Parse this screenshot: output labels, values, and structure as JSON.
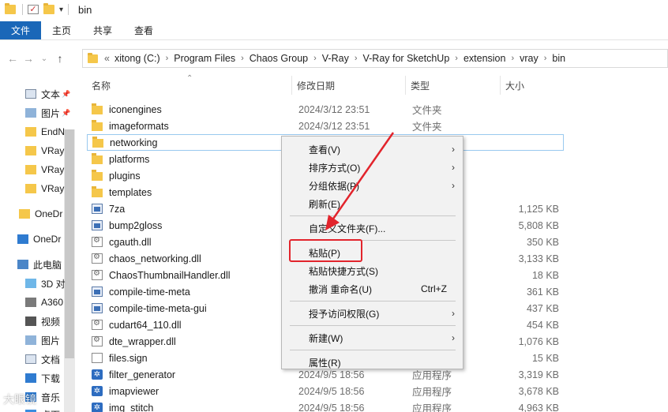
{
  "window": {
    "title": "bin"
  },
  "ribbon": {
    "tabs": [
      "文件",
      "主页",
      "共享",
      "查看"
    ]
  },
  "address": {
    "prefix": "«",
    "crumbs": [
      "xitong (C:)",
      "Program Files",
      "Chaos Group",
      "V-Ray",
      "V-Ray for SketchUp",
      "extension",
      "vray",
      "bin"
    ]
  },
  "nav": {
    "items": [
      {
        "label": "文本",
        "icon": "document-icon",
        "pinned": true
      },
      {
        "label": "图片",
        "icon": "picture-icon",
        "pinned": true
      },
      {
        "label": "EndN",
        "icon": "folder-icon"
      },
      {
        "label": "VRay",
        "icon": "folder-icon"
      },
      {
        "label": "VRay",
        "icon": "folder-icon"
      },
      {
        "label": "VRay",
        "icon": "folder-icon"
      },
      {
        "label": "OneDr",
        "icon": "folder-icon"
      },
      {
        "label": "OneDr",
        "icon": "cloud-icon"
      },
      {
        "label": "此电脑",
        "icon": "computer-icon"
      },
      {
        "label": "3D 对",
        "icon": "cube-icon"
      },
      {
        "label": "A360",
        "icon": "cloud-drive-icon"
      },
      {
        "label": "视频",
        "icon": "video-icon"
      },
      {
        "label": "图片",
        "icon": "picture-icon"
      },
      {
        "label": "文档",
        "icon": "document-icon"
      },
      {
        "label": "下载",
        "icon": "download-icon"
      },
      {
        "label": "音乐",
        "icon": "music-icon"
      },
      {
        "label": "桌面",
        "icon": "desktop-icon"
      }
    ]
  },
  "columns": {
    "name": "名称",
    "date": "修改日期",
    "type": "类型",
    "size": "大小"
  },
  "files": [
    {
      "name": "iconengines",
      "date": "2024/3/12 23:51",
      "type": "文件夹",
      "size": "",
      "icon": "folder"
    },
    {
      "name": "imageformats",
      "date": "2024/3/12 23:51",
      "type": "文件夹",
      "size": "",
      "icon": "folder"
    },
    {
      "name": "networking",
      "date": "",
      "type": "",
      "size": "",
      "icon": "folder",
      "selected": true
    },
    {
      "name": "platforms",
      "date": "",
      "type": "",
      "size": "",
      "icon": "folder"
    },
    {
      "name": "plugins",
      "date": "",
      "type": "",
      "size": "",
      "icon": "folder"
    },
    {
      "name": "templates",
      "date": "",
      "type": "",
      "size": "",
      "icon": "folder"
    },
    {
      "name": "7za",
      "date": "",
      "type": "",
      "size": "1,125 KB",
      "icon": "exe"
    },
    {
      "name": "bump2gloss",
      "date": "",
      "type": "",
      "size": "5,808 KB",
      "icon": "exe"
    },
    {
      "name": "cgauth.dll",
      "date": "",
      "type": "展",
      "size": "350 KB",
      "icon": "dll"
    },
    {
      "name": "chaos_networking.dll",
      "date": "",
      "type": "展",
      "size": "3,133 KB",
      "icon": "dll"
    },
    {
      "name": "ChaosThumbnailHandler.dll",
      "date": "",
      "type": "展",
      "size": "18 KB",
      "icon": "dll"
    },
    {
      "name": "compile-time-meta",
      "date": "",
      "type": "",
      "size": "361 KB",
      "icon": "exe"
    },
    {
      "name": "compile-time-meta-gui",
      "date": "",
      "type": "",
      "size": "437 KB",
      "icon": "exe"
    },
    {
      "name": "cudart64_110.dll",
      "date": "",
      "type": "展",
      "size": "454 KB",
      "icon": "dll"
    },
    {
      "name": "dte_wrapper.dll",
      "date": "",
      "type": "展",
      "size": "1,076 KB",
      "icon": "dll"
    },
    {
      "name": "files.sign",
      "date": "",
      "type": "",
      "size": "15 KB",
      "icon": "sign"
    },
    {
      "name": "filter_generator",
      "date": "2024/9/5 18:56",
      "type": "应用程序",
      "size": "3,319 KB",
      "icon": "blue"
    },
    {
      "name": "imapviewer",
      "date": "2024/9/5 18:56",
      "type": "应用程序",
      "size": "3,678 KB",
      "icon": "blue"
    },
    {
      "name": "img_stitch",
      "date": "2024/9/5 18:56",
      "type": "应用程序",
      "size": "4,963 KB",
      "icon": "blue"
    }
  ],
  "context_menu": {
    "items": [
      {
        "label": "查看(V)",
        "submenu": true
      },
      {
        "label": "排序方式(O)",
        "submenu": true
      },
      {
        "label": "分组依据(P)",
        "submenu": true
      },
      {
        "label": "刷新(E)"
      },
      {
        "sep": true
      },
      {
        "label": "自定义文件夹(F)..."
      },
      {
        "sep": true
      },
      {
        "label": "粘贴(P)",
        "highlighted": true
      },
      {
        "label": "粘贴快捷方式(S)"
      },
      {
        "label": "撤消 重命名(U)",
        "shortcut": "Ctrl+Z"
      },
      {
        "sep": true
      },
      {
        "label": "授予访问权限(G)",
        "submenu": true
      },
      {
        "sep": true
      },
      {
        "label": "新建(W)",
        "submenu": true
      },
      {
        "sep": true
      },
      {
        "label": "属性(R)"
      }
    ]
  },
  "colors": {
    "accent": "#1a67b8",
    "highlight": "#e2242c",
    "selection_border": "#99c9ef"
  },
  "watermark": "大眼镜"
}
